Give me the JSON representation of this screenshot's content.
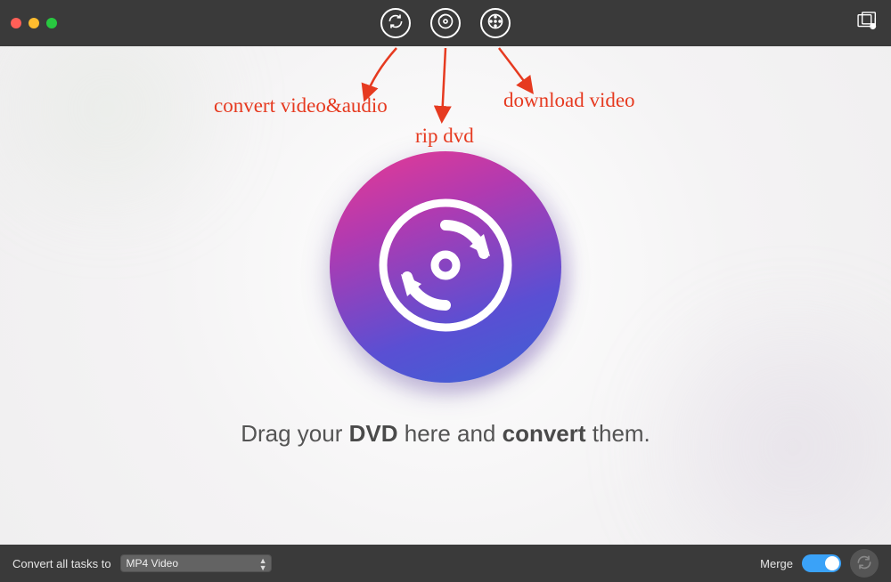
{
  "toolbar": {
    "icons": {
      "convert": "convert-icon",
      "rip": "disc-icon",
      "download": "film-icon",
      "library": "media-library-icon"
    }
  },
  "annotations": {
    "convert": "convert video&audio",
    "rip": "rip dvd",
    "download": "download video"
  },
  "main": {
    "drag_prefix": "Drag your ",
    "drag_bold1": "DVD",
    "drag_mid": " here and ",
    "drag_bold2": "convert",
    "drag_suffix": " them."
  },
  "bottombar": {
    "label": "Convert all tasks to",
    "format_selected": "MP4 Video",
    "merge_label": "Merge",
    "merge_on": true
  },
  "colors": {
    "annotation": "#e63a20",
    "toolbar_bg": "#3a3a3a",
    "accent_gradient_start": "#e83a92",
    "accent_gradient_end": "#3c62d4"
  }
}
